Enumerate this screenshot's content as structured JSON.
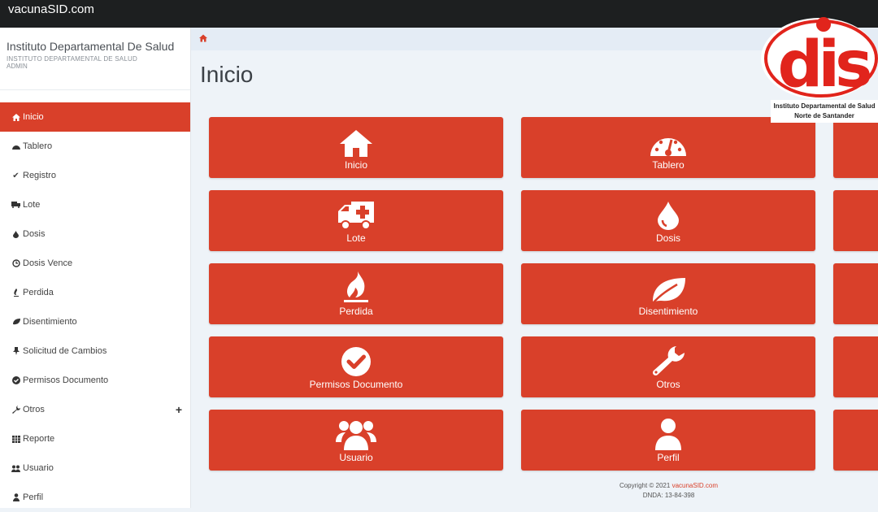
{
  "window": {
    "title": "vacunaSID.com"
  },
  "brand": {
    "title": "Instituto Departamental De Salud",
    "subtitle": "INSTITUTO DEPARTAMENTAL DE SALUD",
    "role": "ADMIN"
  },
  "sidebar": {
    "items": [
      {
        "label": "Inicio",
        "icon": "home-icon",
        "active": true
      },
      {
        "label": "Tablero",
        "icon": "dashboard-icon"
      },
      {
        "label": "Registro",
        "icon": "check-icon"
      },
      {
        "label": "Lote",
        "icon": "truck-icon"
      },
      {
        "label": "Dosis",
        "icon": "drop-icon"
      },
      {
        "label": "Dosis Vence",
        "icon": "clock-icon"
      },
      {
        "label": "Perdida",
        "icon": "fire-icon"
      },
      {
        "label": "Disentimiento",
        "icon": "leaf-icon"
      },
      {
        "label": "Solicitud de Cambios",
        "icon": "pin-icon"
      },
      {
        "label": "Permisos Documento",
        "icon": "check-circle-icon"
      },
      {
        "label": "Otros",
        "icon": "wrench-icon",
        "expand": "+"
      },
      {
        "label": "Reporte",
        "icon": "table-icon"
      },
      {
        "label": "Usuario",
        "icon": "users-icon"
      },
      {
        "label": "Perfil",
        "icon": "user-icon"
      }
    ]
  },
  "main": {
    "title": "Inicio",
    "tiles": [
      {
        "label": "Inicio",
        "icon": "home-icon"
      },
      {
        "label": "Tablero",
        "icon": "dashboard-icon"
      },
      {
        "label": "Lote",
        "icon": "ambulance-icon"
      },
      {
        "label": "Dosis",
        "icon": "drop-icon"
      },
      {
        "label": "Perdida",
        "icon": "fire-icon"
      },
      {
        "label": "Disentimiento",
        "icon": "leaf-icon"
      },
      {
        "label": "Permisos Documento",
        "icon": "check-circle-icon"
      },
      {
        "label": "Otros",
        "icon": "wrench-icon"
      },
      {
        "label": "Usuario",
        "icon": "users-icon"
      },
      {
        "label": "Perfil",
        "icon": "user-icon"
      }
    ]
  },
  "logo": {
    "letters": "dis",
    "line1": "Instituto Departamental de Salud",
    "line2": "Norte de Santander"
  },
  "footer": {
    "copyright": "Copyright © 2021",
    "link": "vacunaSID.com",
    "dnda": "DNDA: 13-84-398"
  },
  "colors": {
    "accent": "#d9402a",
    "topbar": "#1d1f20",
    "background": "#eef3f8"
  }
}
